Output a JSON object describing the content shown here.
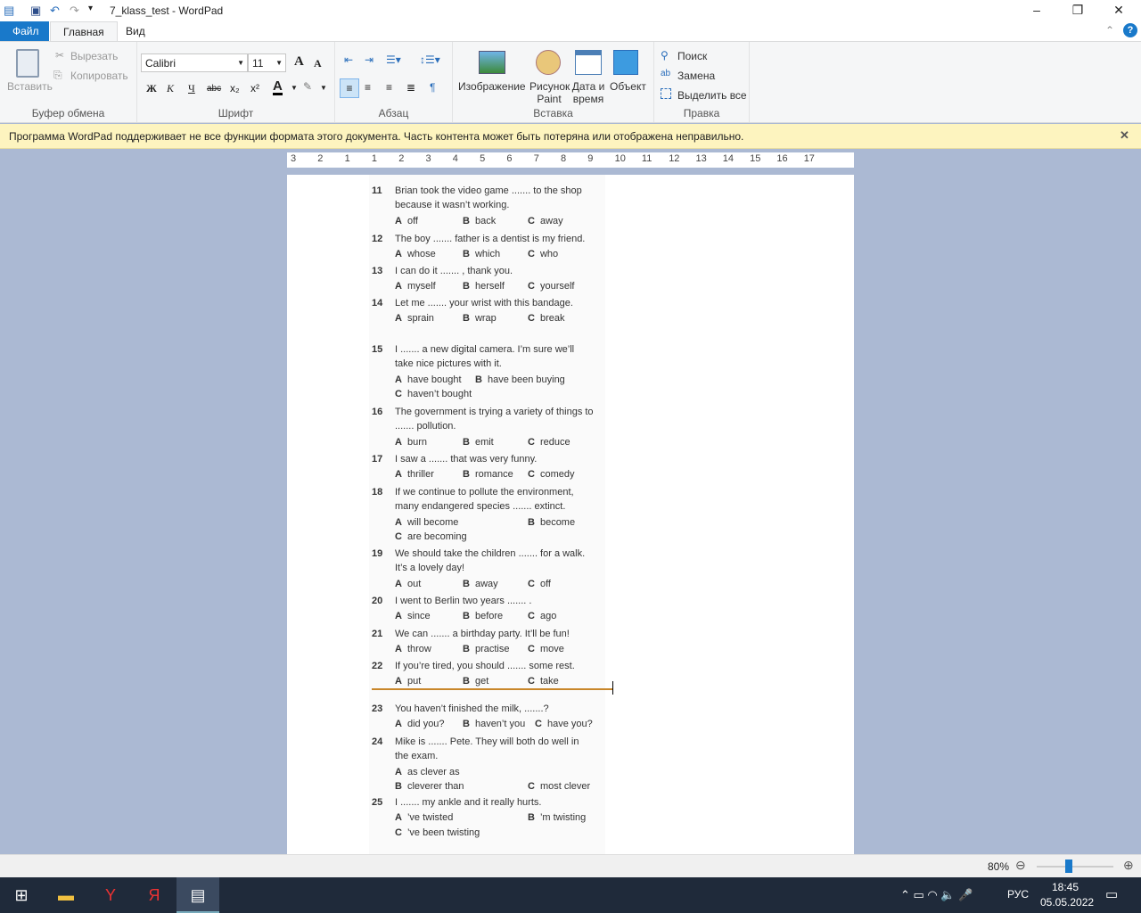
{
  "window": {
    "title": "7_klass_test - WordPad"
  },
  "tabs": [
    {
      "label": "Файл"
    },
    {
      "label": "Главная"
    },
    {
      "label": "Вид"
    }
  ],
  "ribbon": {
    "clipboard": {
      "paste": "Вставить",
      "cut": "Вырезать",
      "copy": "Копировать",
      "label": "Буфер обмена"
    },
    "font": {
      "family": "Calibri",
      "size": "11",
      "bold": "Ж",
      "italic": "К",
      "underline": "Ч",
      "strike": "abc",
      "sub": "x₂",
      "sup": "x²",
      "color": "A",
      "label": "Шрифт"
    },
    "paragraph": {
      "label": "Абзац"
    },
    "insert": {
      "image": "Изображение",
      "paint": "Рисунок Paint",
      "datetime": "Дата и время",
      "object": "Объект",
      "label": "Вставка"
    },
    "edit": {
      "find": "Поиск",
      "replace": "Замена",
      "select_all": "Выделить все",
      "label": "Правка"
    }
  },
  "infobar": {
    "message": "Программа WordPad поддерживает не все функции формата этого документа. Часть контента может быть потеряна или отображена неправильно."
  },
  "ruler": {
    "ticks": [
      "3",
      "2",
      "1",
      "1",
      "2",
      "3",
      "4",
      "5",
      "6",
      "7",
      "8",
      "9",
      "10",
      "11",
      "12",
      "13",
      "14",
      "15",
      "16",
      "17"
    ]
  },
  "questions": [
    {
      "num": "11",
      "lines": [
        "Brian took the video game ....... to the shop",
        "because it wasn’t working."
      ],
      "options": [
        [
          "A",
          "off"
        ],
        [
          "B",
          "back"
        ],
        [
          "C",
          "away"
        ]
      ]
    },
    {
      "num": "12",
      "lines": [
        "The boy ....... father is a dentist is my friend."
      ],
      "options": [
        [
          "A",
          "whose"
        ],
        [
          "B",
          "which"
        ],
        [
          "C",
          "who"
        ]
      ]
    },
    {
      "num": "13",
      "lines": [
        "I can do it ....... , thank you."
      ],
      "options": [
        [
          "A",
          "myself"
        ],
        [
          "B",
          "herself"
        ],
        [
          "C",
          "yourself"
        ]
      ]
    },
    {
      "num": "14",
      "lines": [
        "Let me ....... your wrist with this bandage."
      ],
      "options": [
        [
          "A",
          "sprain"
        ],
        [
          "B",
          "wrap"
        ],
        [
          "C",
          "break"
        ]
      ]
    },
    {
      "num": "15",
      "lines": [
        "I ....... a new digital camera. I’m sure we’ll",
        "take nice pictures with it."
      ],
      "options": [
        [
          "A",
          "have bought"
        ],
        [
          "B",
          "have been buying"
        ],
        [
          "C",
          "haven’t bought"
        ]
      ]
    },
    {
      "num": "16",
      "lines": [
        "The government is trying a variety of things to",
        "....... pollution."
      ],
      "options": [
        [
          "A",
          "burn"
        ],
        [
          "B",
          "emit"
        ],
        [
          "C",
          "reduce"
        ]
      ]
    },
    {
      "num": "17",
      "lines": [
        "I saw a ....... that was very funny."
      ],
      "options": [
        [
          "A",
          "thriller"
        ],
        [
          "B",
          "romance"
        ],
        [
          "C",
          "comedy"
        ]
      ]
    },
    {
      "num": "18",
      "lines": [
        "If we continue to pollute the environment,",
        "many endangered species ....... extinct."
      ],
      "options": [
        [
          "A",
          "will become"
        ],
        [
          "B",
          "become"
        ],
        [
          "C",
          "are becoming"
        ]
      ]
    },
    {
      "num": "19",
      "lines": [
        "We should take the children ....... for a walk.",
        "It’s a lovely day!"
      ],
      "options": [
        [
          "A",
          "out"
        ],
        [
          "B",
          "away"
        ],
        [
          "C",
          "off"
        ]
      ]
    },
    {
      "num": "20",
      "lines": [
        "I went to Berlin two years ....... ."
      ],
      "options": [
        [
          "A",
          "since"
        ],
        [
          "B",
          "before"
        ],
        [
          "C",
          "ago"
        ]
      ]
    },
    {
      "num": "21",
      "lines": [
        "We can ....... a birthday party. It’ll be fun!"
      ],
      "options": [
        [
          "A",
          "throw"
        ],
        [
          "B",
          "practise"
        ],
        [
          "C",
          "move"
        ]
      ]
    },
    {
      "num": "22",
      "lines": [
        "If you’re tired, you should ....... some rest."
      ],
      "options": [
        [
          "A",
          "put"
        ],
        [
          "B",
          "get"
        ],
        [
          "C",
          "take"
        ]
      ]
    },
    {
      "num": "23",
      "lines": [
        "You haven’t finished the milk, .......?"
      ],
      "options": [
        [
          "A",
          "did you?"
        ],
        [
          "B",
          "haven’t you"
        ],
        [
          "C",
          "have you?"
        ]
      ]
    },
    {
      "num": "24",
      "lines": [
        "Mike is ....... Pete. They will both do well in",
        "the exam."
      ],
      "options": [
        [
          "A",
          "as clever as"
        ],
        [
          "B",
          "cleverer than"
        ],
        [
          "C",
          "most clever"
        ]
      ]
    },
    {
      "num": "25",
      "lines": [
        "I ....... my ankle and it really hurts."
      ],
      "options": [
        [
          "A",
          "’ve twisted"
        ],
        [
          "B",
          "’m twisting"
        ],
        [
          "C",
          "’ve been twisting"
        ]
      ]
    }
  ],
  "status": {
    "zoom": "80%",
    "zoom_fraction": 0.42
  },
  "taskbar": {
    "lang": "РУС",
    "time": "18:45",
    "date": "05.05.2022"
  },
  "colors": {
    "file_tab": "#1979ca",
    "infobar": "#fdf4bf",
    "taskbar": "#1f2a3a",
    "divider": "#c8862a"
  }
}
